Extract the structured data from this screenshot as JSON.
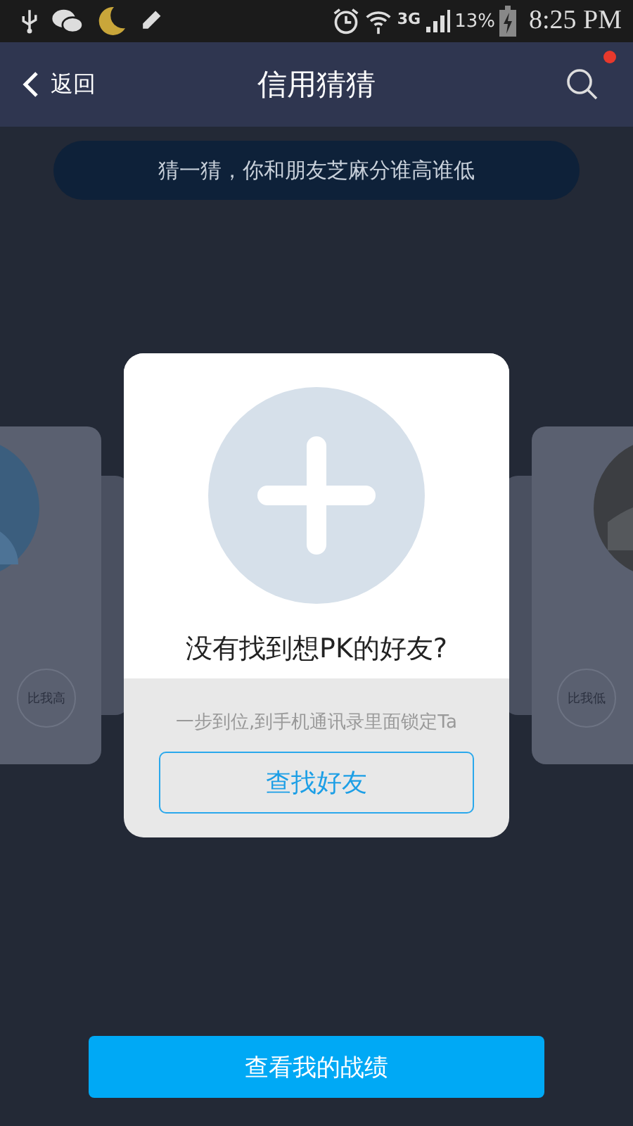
{
  "status_bar": {
    "network": "3G",
    "battery": "13%",
    "time": "8:25 PM"
  },
  "nav": {
    "back": "返回",
    "title": "信用猜猜",
    "search_badge": true
  },
  "banner": "猜一猜，你和朋友芝麻分谁高谁低",
  "side_cards": [
    {
      "kind": "left",
      "label": "比我高"
    },
    {
      "kind": "right",
      "label": "比我低"
    }
  ],
  "dialog": {
    "heading": "没有找到想PK的好友?",
    "hint": "一步到位,到手机通讯录里面锁定Ta",
    "button": "查找好友"
  },
  "bottom_button": "查看我的战绩"
}
